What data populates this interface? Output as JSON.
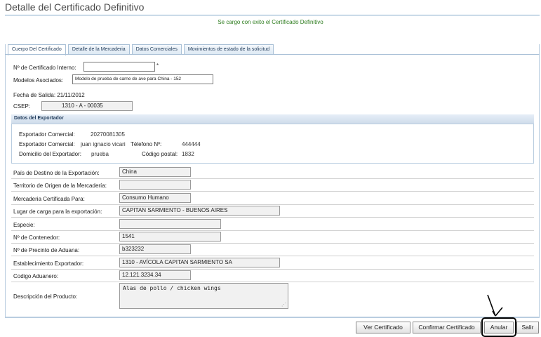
{
  "page": {
    "title": "Detalle del Certificado Definitivo",
    "success_message": "Se cargo con exito el Certificado Definitivo"
  },
  "tabs": [
    {
      "label": "Cuerpo Del Certificado",
      "active": true
    },
    {
      "label": "Detalle de la Mercaderia",
      "active": false
    },
    {
      "label": "Datos Comerciales",
      "active": false
    },
    {
      "label": "Movimientos de estado de la solicitud",
      "active": false
    }
  ],
  "header_fields": {
    "certificado_interno_label": "Nº de Certificado Interno:",
    "certificado_interno_value": "",
    "required_mark": "*",
    "modelos_label": "Modelos Asociados:",
    "modelos_value": "Modelo de prueba de carne de ave para China - 152",
    "fecha_salida": "Fecha de Salida: 21/11/2012",
    "csep_label": "CSEP:",
    "csep_value": "1310 - A - 00035"
  },
  "exportador": {
    "section_title": "Datos del Exportador",
    "comercial1_label": "Exportador Comercial:",
    "comercial1_value": "20270081305",
    "comercial2_label": "Exportador Comercial:",
    "comercial2_value": "juan ignacio vicari",
    "telefono_label": "Télefono Nº:",
    "telefono_value": "444444",
    "domicilio_label": "Domicilio del Exportador:",
    "domicilio_value": "prueba",
    "codigo_postal_label": "Código postal:",
    "codigo_postal_value": "1832"
  },
  "details": {
    "pais_destino_label": "País de Destino de la Exportación:",
    "pais_destino_value": "China",
    "territorio_label": "Territorio de Origen de la Mercadería:",
    "territorio_value": "",
    "mercaderia_label": "Mercaderia Certificada Para:",
    "mercaderia_value": "Consumo Humano",
    "lugar_carga_label": "Lugar de carga para la exportación:",
    "lugar_carga_value": "CAPITAN SARMIENTO - BUENOS AIRES",
    "especie_label": "Especie:",
    "especie_value": "",
    "contenedor_label": "Nº de Contenedor:",
    "contenedor_value": "1541",
    "precinto_label": "Nº de Precinto de Aduana:",
    "precinto_value": "b323232",
    "establecimiento_label": "Establecimiento Exportador:",
    "establecimiento_value": "1310 - AVÍCOLA CAPITAN SARMIENTO SA",
    "codigo_aduanero_label": "Codigo Aduanero:",
    "codigo_aduanero_value": "12.121.3234.34",
    "descripcion_label": "Descripción del Producto:",
    "descripcion_value": "Alas de pollo / chicken wings"
  },
  "buttons": {
    "ver": "Ver Certificado",
    "confirmar": "Confirmar Certificado",
    "anular": "Anular",
    "salir": "Salir"
  },
  "colors": {
    "accent": "#7fa7c9",
    "success": "#2e7d1f"
  },
  "icons": {
    "annotation": "arrow-pointer-icon",
    "resize": "resize-grip-icon"
  }
}
